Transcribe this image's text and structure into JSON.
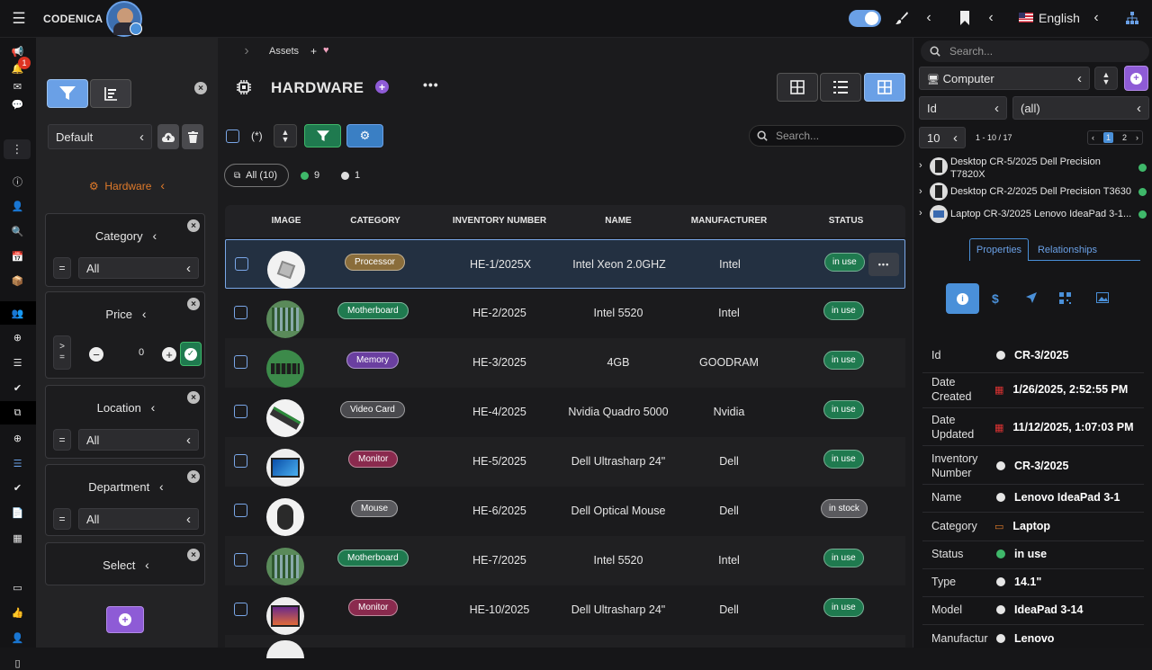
{
  "header": {
    "brand": "CODENICA",
    "language": "English",
    "notif_count": "1"
  },
  "breadcrumb": {
    "item": "Assets",
    "plus": "+"
  },
  "filters": {
    "preset": "Default",
    "group_label": "Hardware",
    "category": {
      "title": "Category",
      "op": "=",
      "value": "All"
    },
    "price": {
      "title": "Price",
      "value": "0"
    },
    "location": {
      "title": "Location",
      "op": "=",
      "value": "All"
    },
    "department": {
      "title": "Department",
      "op": "=",
      "value": "All"
    },
    "select": {
      "title": "Select"
    }
  },
  "main": {
    "title": "HARDWARE",
    "any_label": "(*)",
    "search_placeholder": "Search...",
    "chips": {
      "all": "All (10)",
      "green_count": "9",
      "gray_count": "1"
    },
    "columns": [
      "IMAGE",
      "CATEGORY",
      "INVENTORY NUMBER",
      "NAME",
      "MANUFACTURER",
      "STATUS"
    ],
    "rows": [
      {
        "category": "Processor",
        "cat_color": "#8a6d3b",
        "inv": "HE-1/2025X",
        "name": "Intel Xeon 2.0GHZ",
        "mfr": "Intel",
        "status": "in use"
      },
      {
        "category": "Motherboard",
        "cat_color": "#1f7a4f",
        "inv": "HE-2/2025",
        "name": "Intel 5520",
        "mfr": "Intel",
        "status": "in use"
      },
      {
        "category": "Memory",
        "cat_color": "#6a3fa0",
        "inv": "HE-3/2025",
        "name": "4GB",
        "mfr": "GOODRAM",
        "status": "in use"
      },
      {
        "category": "Video Card",
        "cat_color": "#4a4a4e",
        "inv": "HE-4/2025",
        "name": "Nvidia Quadro 5000",
        "mfr": "Nvidia",
        "status": "in use"
      },
      {
        "category": "Monitor",
        "cat_color": "#8a2a4e",
        "inv": "HE-5/2025",
        "name": "Dell Ultrasharp 24\"",
        "mfr": "Dell",
        "status": "in use"
      },
      {
        "category": "Mouse",
        "cat_color": "#5a5a5e",
        "inv": "HE-6/2025",
        "name": "Dell Optical Mouse",
        "mfr": "Dell",
        "status": "in stock"
      },
      {
        "category": "Motherboard",
        "cat_color": "#1f7a4f",
        "inv": "HE-7/2025",
        "name": "Intel 5520",
        "mfr": "Intel",
        "status": "in use"
      },
      {
        "category": "Monitor",
        "cat_color": "#8a2a4e",
        "inv": "HE-10/2025",
        "name": "Dell Ultrasharp 24\"",
        "mfr": "Dell",
        "status": "in use"
      }
    ]
  },
  "right": {
    "search_placeholder": "Search...",
    "type": "Computer",
    "field": "Id",
    "field_value": "(all)",
    "page_size": "10",
    "range": "1 - 10 / 17",
    "pages": [
      "1",
      "2"
    ],
    "list": [
      {
        "text": "Desktop CR-5/2025 Dell Precision T7820X"
      },
      {
        "text": "Desktop CR-2/2025 Dell Precision T3630"
      },
      {
        "text": "Laptop CR-3/2025 Lenovo IdeaPad 3-1..."
      }
    ],
    "tabs": {
      "properties": "Properties",
      "relationships": "Relationships"
    },
    "props": [
      {
        "k": "Id",
        "v": "CR-3/2025"
      },
      {
        "k": "Date Created",
        "v": "1/26/2025, 2:52:55 PM"
      },
      {
        "k": "Date Updated",
        "v": "11/12/2025, 1:07:03 PM"
      },
      {
        "k": "Inventory Number",
        "v": "CR-3/2025"
      },
      {
        "k": "Name",
        "v": "Lenovo IdeaPad 3-1"
      },
      {
        "k": "Category",
        "v": "Laptop"
      },
      {
        "k": "Status",
        "v": "in use"
      },
      {
        "k": "Type",
        "v": "14.1\""
      },
      {
        "k": "Model",
        "v": "IdeaPad 3-14"
      },
      {
        "k": "Manufactur",
        "v": "Lenovo"
      }
    ]
  },
  "colors": {
    "accent": "#4a90d9",
    "green": "#1f7a4f",
    "purple": "#8e5bd6"
  }
}
